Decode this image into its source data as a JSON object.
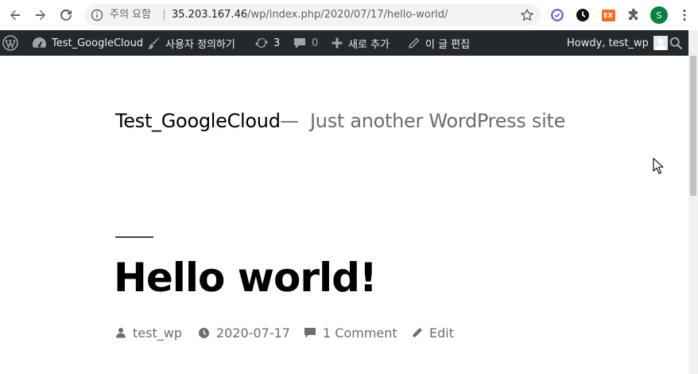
{
  "browser": {
    "security_label": "주의 요함",
    "url_host": "35.203.167.46",
    "url_path": "/wp/index.php/2020/07/17/hello-world/",
    "profile_initial": "S",
    "ext_label": "EX"
  },
  "adminbar": {
    "site_name": "Test_GoogleCloud",
    "customize": "사용자 정의하기",
    "updates_count": "3",
    "comments_count": "0",
    "new_label": "새로 추가",
    "edit_label": "이 글 편집",
    "howdy": "Howdy, test_wp"
  },
  "site": {
    "title": "Test_GoogleCloud",
    "separator": "—",
    "description": "Just another WordPress site"
  },
  "post": {
    "title": "Hello world!",
    "author": "test_wp",
    "date": "2020-07-17",
    "comments": "1 Comment",
    "edit": "Edit"
  },
  "colors": {
    "adminbar_bg": "#23282d",
    "meta_text": "#6d6d6d",
    "profile_green": "#0b8043",
    "ext_orange": "#f36a21"
  }
}
